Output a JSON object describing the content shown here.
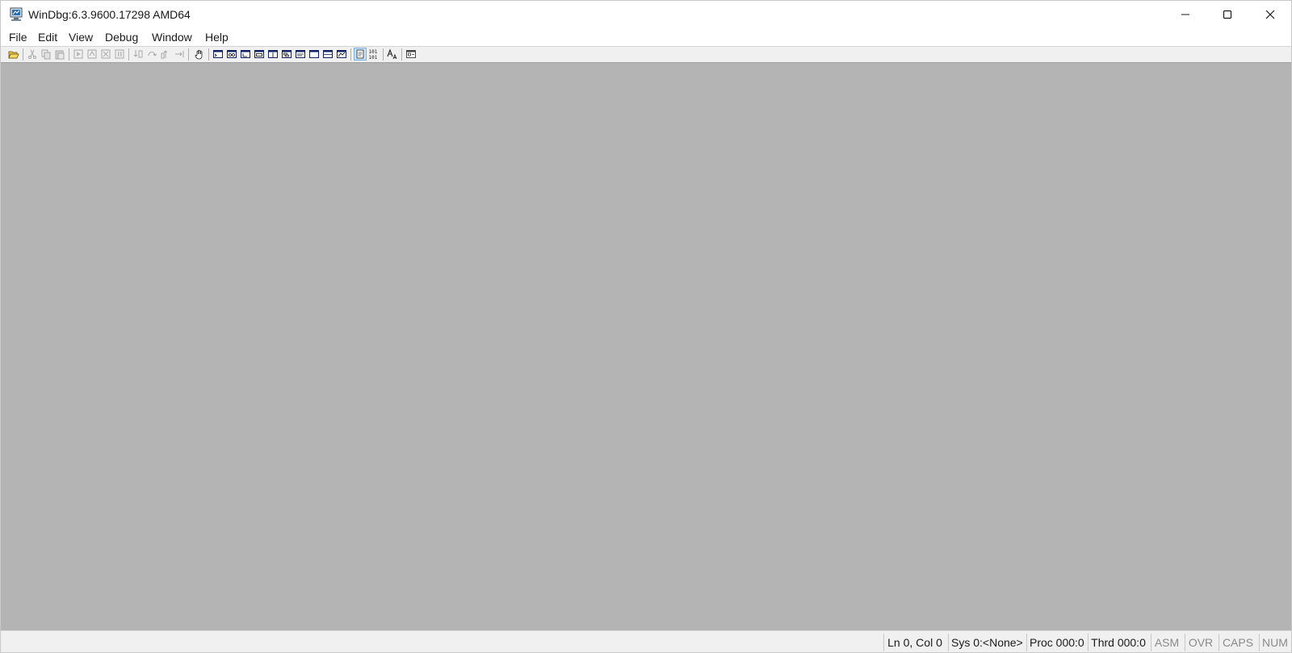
{
  "window": {
    "title": "WinDbg:6.3.9600.17298 AMD64"
  },
  "menu": {
    "items": [
      {
        "label": "File"
      },
      {
        "label": "Edit"
      },
      {
        "label": "View"
      },
      {
        "label": "Debug"
      },
      {
        "label": "Window"
      },
      {
        "label": "Help"
      }
    ]
  },
  "toolbar": {
    "icons": [
      "open-folder-icon",
      "cut-icon",
      "copy-icon",
      "paste-icon",
      "go-icon",
      "restart-icon",
      "stop-debugging-icon",
      "break-icon",
      "step-into-icon",
      "step-over-icon",
      "step-out-icon",
      "run-to-cursor-icon",
      "hand-icon",
      "command-window-icon",
      "watch-window-icon",
      "locals-window-icon",
      "registers-window-icon",
      "memory-window-icon",
      "call-stack-icon",
      "disassembly-window-icon",
      "scratch-pad-icon",
      "processes-threads-icon",
      "source-mode-icon",
      "binary-mode-icon",
      "font-icon",
      "options-icon"
    ]
  },
  "status": {
    "position": "Ln 0, Col 0",
    "system": "Sys 0:<None>",
    "process": "Proc 000:0",
    "thread": "Thrd 000:0",
    "asm": "ASM",
    "ovr": "OVR",
    "caps": "CAPS",
    "num": "NUM"
  },
  "colors": {
    "client_background": "#b4b4b4",
    "chrome_background": "#f0f0f0",
    "title_background": "#ffffff",
    "inactive_text": "#8a8a8a"
  }
}
